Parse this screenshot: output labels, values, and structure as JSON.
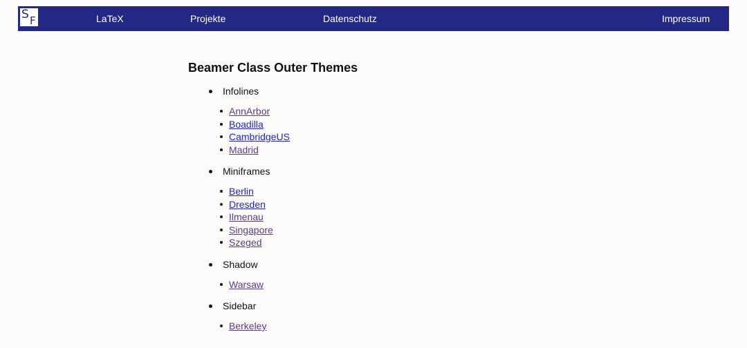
{
  "header": {
    "logo_s": "S",
    "logo_f": "F",
    "nav": [
      "LaTeX",
      "Projekte",
      "Datenschutz",
      "Impressum"
    ]
  },
  "main": {
    "title": "Beamer Class Outer Themes",
    "groups": [
      {
        "label": "Infolines",
        "themes": [
          "AnnArbor",
          "Boadilla",
          "CambridgeUS",
          "Madrid"
        ]
      },
      {
        "label": "Miniframes",
        "themes": [
          "Berlin",
          "Dresden",
          "Ilmenau",
          "Singapore",
          "Szeged"
        ]
      },
      {
        "label": "Shadow",
        "themes": [
          "Warsaw"
        ]
      },
      {
        "label": "Sidebar",
        "themes": [
          "Berkeley"
        ]
      }
    ]
  },
  "colors": {
    "navbar": "#232884",
    "background": "#fdfcfa",
    "link": "#2323c8",
    "link_visited": "#5b3a8c"
  }
}
